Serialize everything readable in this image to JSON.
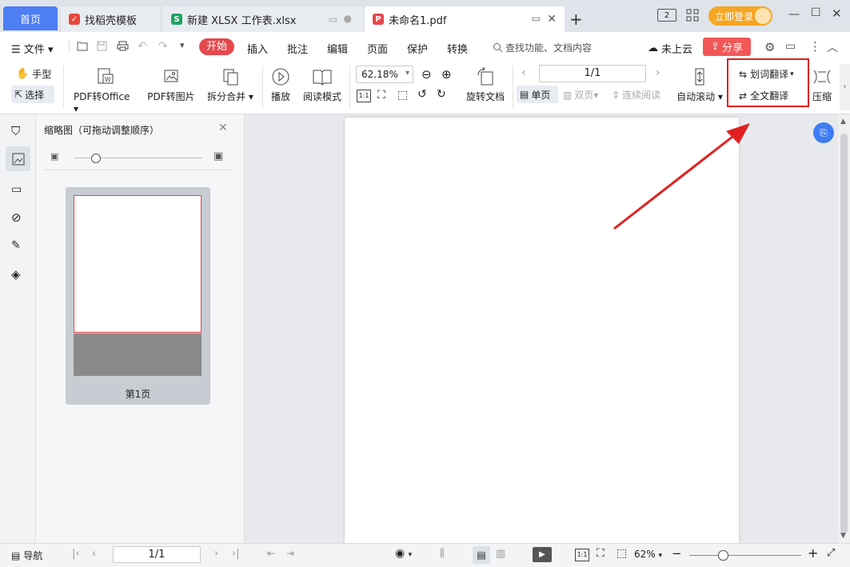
{
  "tabs": {
    "home": "首页",
    "templates": "找稻壳模板",
    "xlsx": "新建 XLSX 工作表.xlsx",
    "pdf": "未命名1.pdf",
    "new_tab": "+"
  },
  "window": {
    "login": "立即登录",
    "page_badge": "2"
  },
  "menubar": {
    "file": "文件",
    "start": "开始",
    "insert": "插入",
    "annotate": "批注",
    "edit": "编辑",
    "page": "页面",
    "protect": "保护",
    "convert": "转换",
    "search_placeholder": "查找功能、文档内容",
    "cloud": "未上云",
    "share": "分享"
  },
  "ribbon": {
    "hand": "手型",
    "select": "选择",
    "pdf_to_office": "PDF转Office",
    "pdf_to_image": "PDF转图片",
    "split_merge": "拆分合并",
    "play": "播放",
    "read_mode": "阅读模式",
    "zoom": "62.18%",
    "rotate_doc": "旋转文档",
    "page_num": "1/1",
    "single_page": "单页",
    "double_page": "双页",
    "continuous": "连续阅读",
    "auto_scroll": "自动滚动",
    "word_translate": "划词翻译",
    "full_translate": "全文翻译",
    "compress": "压缩"
  },
  "thumbnail_panel": {
    "title": "缩略图（可拖动调整顺序）",
    "page_label": "第1页"
  },
  "statusbar": {
    "nav": "导航",
    "page_num": "1/1",
    "zoom": "62%"
  },
  "colors": {
    "accent_blue": "#4d7ef3",
    "start_red": "#e5484d",
    "share_red": "#f25757",
    "highlight_red": "#e02020",
    "login_orange": "#f5a623"
  }
}
